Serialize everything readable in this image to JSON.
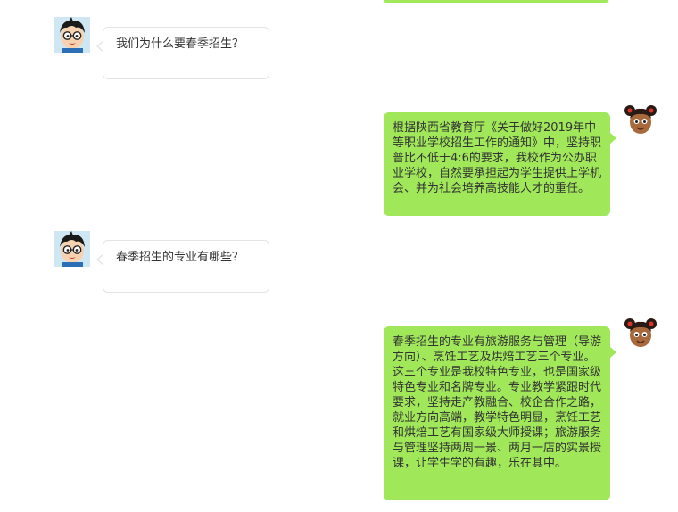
{
  "colors": {
    "user_bubble": "#a0e75a",
    "other_bubble_bg": "#ffffff",
    "other_bubble_border": "#e4e4e4",
    "text": "#333333"
  },
  "messages": [
    {
      "side": "left",
      "avatar": "boy-glasses-avatar-icon",
      "text": "我们为什么要春季招生？"
    },
    {
      "side": "right",
      "avatar": "girl-dark-avatar-icon",
      "text": "根据陕西省教育厅《关于做好2019年中等职业学校招生工作的通知》中，坚持职普比不低于4:6的要求，我校作为公办职业学校，自然要承担起为学生提供上学机会、并为社会培养高技能人才的重任。"
    },
    {
      "side": "left",
      "avatar": "boy-glasses-avatar-icon",
      "text": "春季招生的专业有哪些？"
    },
    {
      "side": "right",
      "avatar": "girl-dark-avatar-icon",
      "text": "春季招生的专业有旅游服务与管理（导游方向）、烹饪工艺及烘焙工艺三个专业。这三个专业是我校特色专业，也是国家级特色专业和名牌专业。专业教学紧跟时代要求，坚持走产教融合、校企合作之路，就业方向高端，教学特色明显，烹饪工艺和烘焙工艺有国家级大师授课；旅游服务与管理坚持两周一景、两月一店的实景授课，让学生学的有趣，乐在其中。"
    }
  ]
}
